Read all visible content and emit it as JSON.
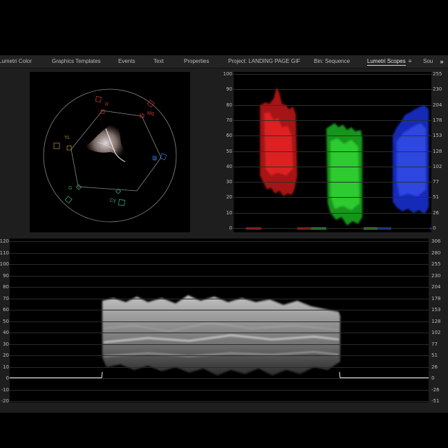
{
  "tabs": [
    {
      "label": "Lumetri Color",
      "active": false
    },
    {
      "label": "Graphics Templates",
      "active": false
    },
    {
      "label": "Events",
      "active": false
    },
    {
      "label": "Text",
      "active": false
    },
    {
      "label": "Properties",
      "active": false
    },
    {
      "label": "Project: LANDING PAGE GIF",
      "active": false
    },
    {
      "label": "Bin: Sequence",
      "active": false
    },
    {
      "label": "Lumetri Scopes",
      "active": true
    },
    {
      "label": "Sou",
      "active": false
    }
  ],
  "tab_menu_icon": "hamburger-menu-icon",
  "overflow_icon": "double-chevron-right-icon",
  "overflow_glyph": "»",
  "vectorscope": {
    "targets": [
      {
        "label": "R",
        "color": "#c0392b"
      },
      {
        "label": "Mg",
        "color": "#c0392b"
      },
      {
        "label": "B",
        "color": "#2f6fd1"
      },
      {
        "label": "Cy",
        "color": "#2e9e8e"
      },
      {
        "label": "G",
        "color": "#3aa35a"
      },
      {
        "label": "YL",
        "color": "#b08a3c"
      }
    ]
  },
  "parade": {
    "left_ticks": [
      "100",
      "90",
      "80",
      "70",
      "60",
      "50",
      "40",
      "30",
      "20",
      "10",
      "0"
    ],
    "right_ticks": [
      "255",
      "230",
      "204",
      "178",
      "153",
      "128",
      "102",
      "77",
      "51",
      "26",
      "0"
    ],
    "channel_colors": [
      "#e01010",
      "#16c21a",
      "#1c3bf0"
    ]
  },
  "waveform": {
    "left_ticks": [
      "120",
      "110",
      "100",
      "90",
      "80",
      "70",
      "60",
      "50",
      "40",
      "30",
      "20",
      "10",
      "0",
      "-10",
      "-20"
    ],
    "right_ticks": [
      "306",
      "280",
      "255",
      "230",
      "204",
      "178",
      "153",
      "128",
      "102",
      "77",
      "51",
      "26",
      "0",
      "-26",
      "-51"
    ]
  }
}
